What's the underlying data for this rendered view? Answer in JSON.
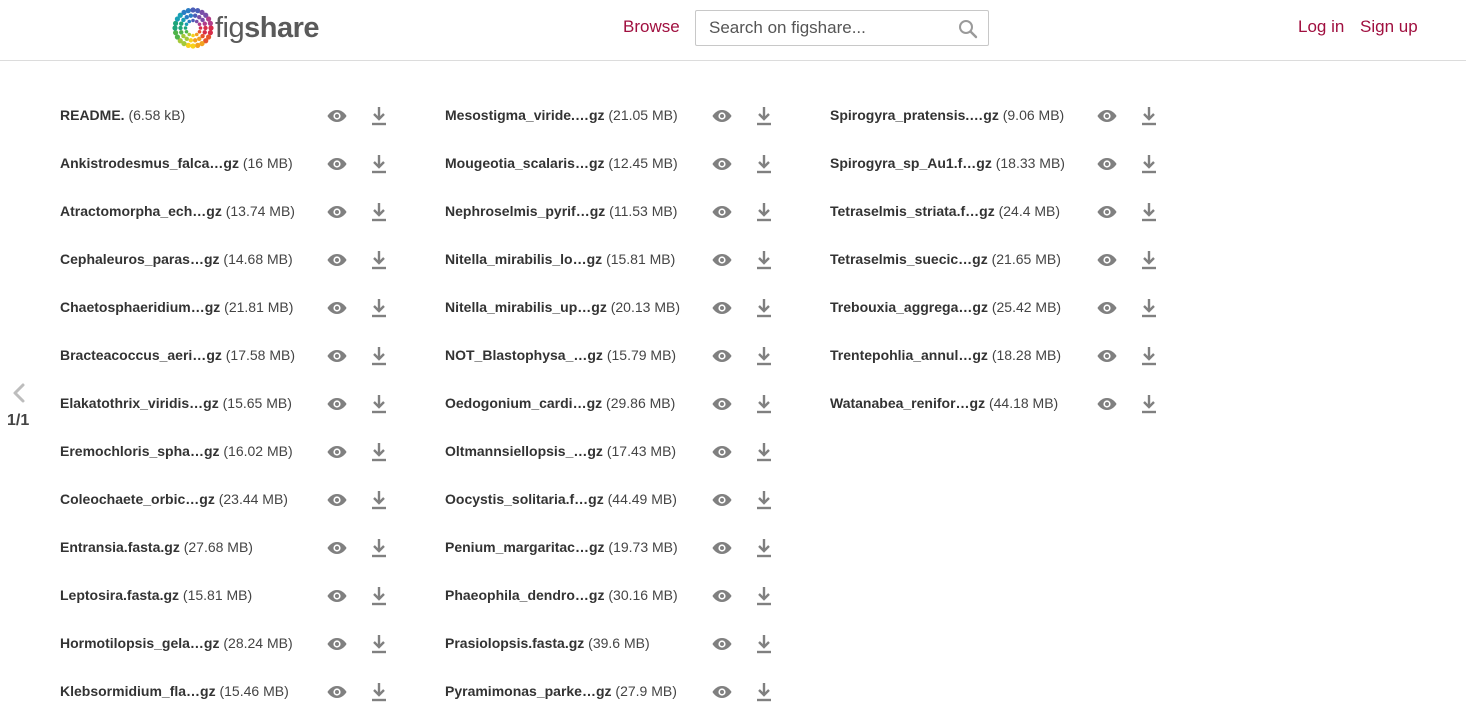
{
  "header": {
    "logo_fig": "fig",
    "logo_share": "share",
    "browse_label": "Browse",
    "search_placeholder": "Search on figshare...",
    "login_label": "Log in",
    "signup_label": "Sign up",
    "accent_color": "#a00f3f"
  },
  "pager": {
    "label": "1/1",
    "prev_icon": "chevron-left-icon"
  },
  "files": {
    "columns": [
      [
        {
          "name": "README.",
          "ext": "",
          "size": "(6.58 kB)"
        },
        {
          "name": "Ankistrodesmus_falca…",
          "ext": "gz",
          "size": "(16 MB)"
        },
        {
          "name": "Atractomorpha_ech…",
          "ext": "gz",
          "size": "(13.74 MB)"
        },
        {
          "name": "Cephaleuros_paras…",
          "ext": "gz",
          "size": "(14.68 MB)"
        },
        {
          "name": "Chaetosphaeridium…",
          "ext": "gz",
          "size": "(21.81 MB)"
        },
        {
          "name": "Bracteacoccus_aeri…",
          "ext": "gz",
          "size": "(17.58 MB)"
        },
        {
          "name": "Elakatothrix_viridis…",
          "ext": "gz",
          "size": "(15.65 MB)"
        },
        {
          "name": "Eremochloris_spha…",
          "ext": "gz",
          "size": "(16.02 MB)"
        },
        {
          "name": "Coleochaete_orbic…",
          "ext": "gz",
          "size": "(23.44 MB)"
        },
        {
          "name": "Entransia.fasta.gz",
          "ext": "",
          "size": "(27.68 MB)"
        },
        {
          "name": "Leptosira.fasta.gz",
          "ext": "",
          "size": "(15.81 MB)"
        },
        {
          "name": "Hormotilopsis_gela…",
          "ext": "gz",
          "size": "(28.24 MB)"
        },
        {
          "name": "Klebsormidium_fla…",
          "ext": "gz",
          "size": "(15.46 MB)"
        }
      ],
      [
        {
          "name": "Mesostigma_viride.…",
          "ext": "gz",
          "size": "(21.05 MB)"
        },
        {
          "name": "Mougeotia_scalaris…",
          "ext": "gz",
          "size": "(12.45 MB)"
        },
        {
          "name": "Nephroselmis_pyrif…",
          "ext": "gz",
          "size": "(11.53 MB)"
        },
        {
          "name": "Nitella_mirabilis_lo…",
          "ext": "gz",
          "size": "(15.81 MB)"
        },
        {
          "name": "Nitella_mirabilis_up…",
          "ext": "gz",
          "size": "(20.13 MB)"
        },
        {
          "name": "NOT_Blastophysa_…",
          "ext": "gz",
          "size": "(15.79 MB)"
        },
        {
          "name": "Oedogonium_cardi…",
          "ext": "gz",
          "size": "(29.86 MB)"
        },
        {
          "name": "Oltmannsiellopsis_…",
          "ext": "gz",
          "size": "(17.43 MB)"
        },
        {
          "name": "Oocystis_solitaria.f…",
          "ext": "gz",
          "size": "(44.49 MB)"
        },
        {
          "name": "Penium_margaritac…",
          "ext": "gz",
          "size": "(19.73 MB)"
        },
        {
          "name": "Phaeophila_dendro…",
          "ext": "gz",
          "size": "(30.16 MB)"
        },
        {
          "name": "Prasiolopsis.fasta.gz",
          "ext": "",
          "size": "(39.6 MB)"
        },
        {
          "name": "Pyramimonas_parke…",
          "ext": "gz",
          "size": "(27.9 MB)"
        }
      ],
      [
        {
          "name": "Spirogyra_pratensis.…",
          "ext": "gz",
          "size": "(9.06 MB)"
        },
        {
          "name": "Spirogyra_sp_Au1.f…",
          "ext": "gz",
          "size": "(18.33 MB)"
        },
        {
          "name": "Tetraselmis_striata.f…",
          "ext": "gz",
          "size": "(24.4 MB)"
        },
        {
          "name": "Tetraselmis_suecic…",
          "ext": "gz",
          "size": "(21.65 MB)"
        },
        {
          "name": "Trebouxia_aggrega…",
          "ext": "gz",
          "size": "(25.42 MB)"
        },
        {
          "name": "Trentepohlia_annul…",
          "ext": "gz",
          "size": "(18.28 MB)"
        },
        {
          "name": "Watanabea_renifor…",
          "ext": "gz",
          "size": "(44.18 MB)"
        }
      ]
    ],
    "actions": {
      "preview_icon": "eye-icon",
      "download_icon": "download-icon"
    }
  }
}
